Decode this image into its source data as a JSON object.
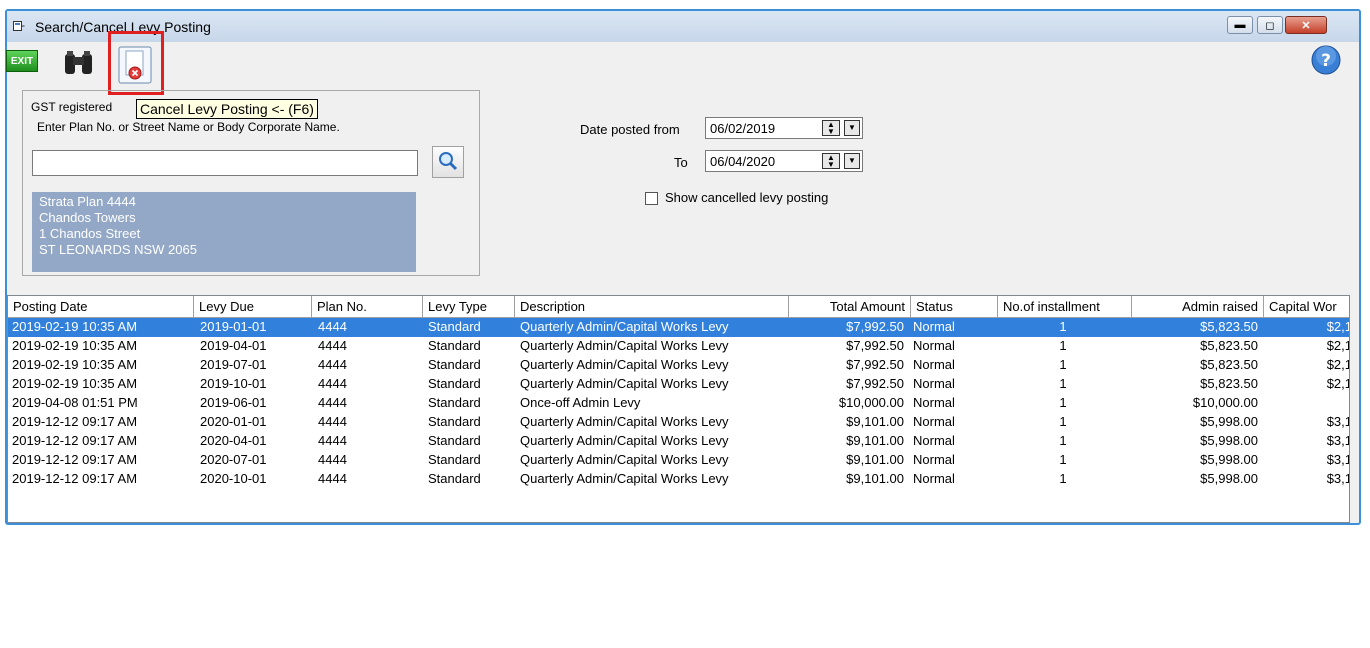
{
  "window": {
    "title": "Search/Cancel Levy Posting"
  },
  "toolbar": {
    "exit_label": "EXIT",
    "tooltip": "Cancel Levy Posting <- (F6)",
    "help_label": "?"
  },
  "left_panel": {
    "group_label": "GST registered",
    "enter_label": "Enter Plan No. or Street Name or Body Corporate Name.",
    "plan_input_value": "",
    "address_lines": [
      "Strata Plan 4444",
      "Chandos Towers",
      "1 Chandos Street",
      "ST LEONARDS  NSW  2065"
    ]
  },
  "filters": {
    "date_from_label": "Date posted from",
    "date_from": "06/02/2019",
    "to_label": "To",
    "date_to": "06/04/2020",
    "show_cancelled_label": "Show cancelled levy posting",
    "show_cancelled_checked": false
  },
  "grid": {
    "columns": [
      "Posting Date",
      "Levy Due",
      "Plan No.",
      "Levy Type",
      "Description",
      "Total Amount",
      "Status",
      "No.of installment",
      "Admin raised",
      "Capital Wor"
    ],
    "rows": [
      [
        "2019-02-19  10:35 AM",
        "2019-01-01",
        "4444",
        "Standard",
        "Quarterly Admin/Capital Works Levy",
        "$7,992.50",
        "Normal",
        "1",
        "$5,823.50",
        "$2,1"
      ],
      [
        "2019-02-19  10:35 AM",
        "2019-04-01",
        "4444",
        "Standard",
        "Quarterly Admin/Capital Works Levy",
        "$7,992.50",
        "Normal",
        "1",
        "$5,823.50",
        "$2,1"
      ],
      [
        "2019-02-19  10:35 AM",
        "2019-07-01",
        "4444",
        "Standard",
        "Quarterly Admin/Capital Works Levy",
        "$7,992.50",
        "Normal",
        "1",
        "$5,823.50",
        "$2,1"
      ],
      [
        "2019-02-19  10:35 AM",
        "2019-10-01",
        "4444",
        "Standard",
        "Quarterly Admin/Capital Works Levy",
        "$7,992.50",
        "Normal",
        "1",
        "$5,823.50",
        "$2,1"
      ],
      [
        "2019-04-08  01:51 PM",
        "2019-06-01",
        "4444",
        "Standard",
        "Once-off Admin Levy",
        "$10,000.00",
        "Normal",
        "1",
        "$10,000.00",
        ""
      ],
      [
        "2019-12-12  09:17 AM",
        "2020-01-01",
        "4444",
        "Standard",
        "Quarterly Admin/Capital Works Levy",
        "$9,101.00",
        "Normal",
        "1",
        "$5,998.00",
        "$3,1"
      ],
      [
        "2019-12-12  09:17 AM",
        "2020-04-01",
        "4444",
        "Standard",
        "Quarterly Admin/Capital Works Levy",
        "$9,101.00",
        "Normal",
        "1",
        "$5,998.00",
        "$3,1"
      ],
      [
        "2019-12-12  09:17 AM",
        "2020-07-01",
        "4444",
        "Standard",
        "Quarterly Admin/Capital Works Levy",
        "$9,101.00",
        "Normal",
        "1",
        "$5,998.00",
        "$3,1"
      ],
      [
        "2019-12-12  09:17 AM",
        "2020-10-01",
        "4444",
        "Standard",
        "Quarterly Admin/Capital Works Levy",
        "$9,101.00",
        "Normal",
        "1",
        "$5,998.00",
        "$3,1"
      ]
    ],
    "selected_row": 0
  },
  "colors": {
    "accent": "#3080dc",
    "address_bg": "#93a8c6",
    "highlight": "#e02020"
  }
}
